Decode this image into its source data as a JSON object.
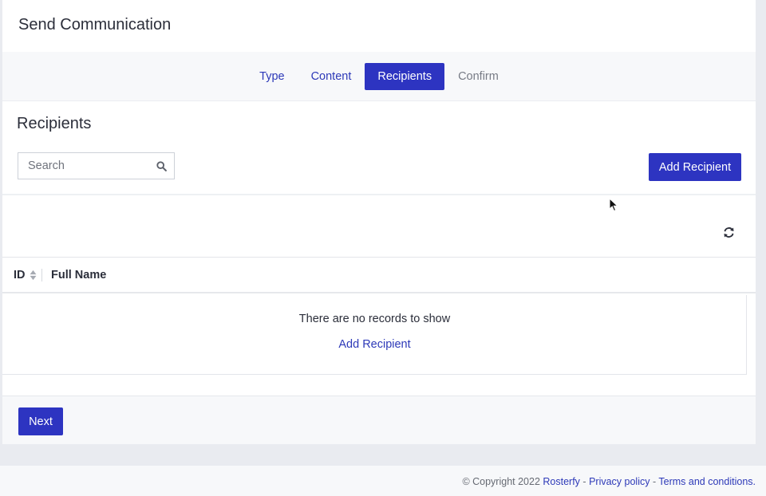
{
  "header": {
    "title": "Send Communication"
  },
  "stepper": {
    "steps": [
      {
        "label": "Type",
        "state": "done"
      },
      {
        "label": "Content",
        "state": "done"
      },
      {
        "label": "Recipients",
        "state": "active"
      },
      {
        "label": "Confirm",
        "state": "disabled"
      }
    ]
  },
  "recipients": {
    "title": "Recipients",
    "search": {
      "placeholder": "Search",
      "value": "",
      "icon": "search-icon"
    },
    "add_button_label": "Add Recipient",
    "refresh_icon": "refresh-icon",
    "table": {
      "columns": [
        {
          "label": "ID",
          "sortable": true
        },
        {
          "label": "Full Name",
          "sortable": false
        }
      ],
      "rows": [],
      "empty_message": "There are no records to show",
      "empty_action_label": "Add Recipient"
    }
  },
  "actions": {
    "next_label": "Next"
  },
  "footer": {
    "copyright": "© Copyright 2022",
    "brand_link": "Rosterfy",
    "separator": "-",
    "privacy_link": "Privacy policy",
    "terms_link": "Terms and conditions."
  },
  "colors": {
    "primary": "#2d34c1",
    "link": "#2d39b8",
    "muted_text": "#777b85",
    "page_background": "#e9ebf0"
  }
}
